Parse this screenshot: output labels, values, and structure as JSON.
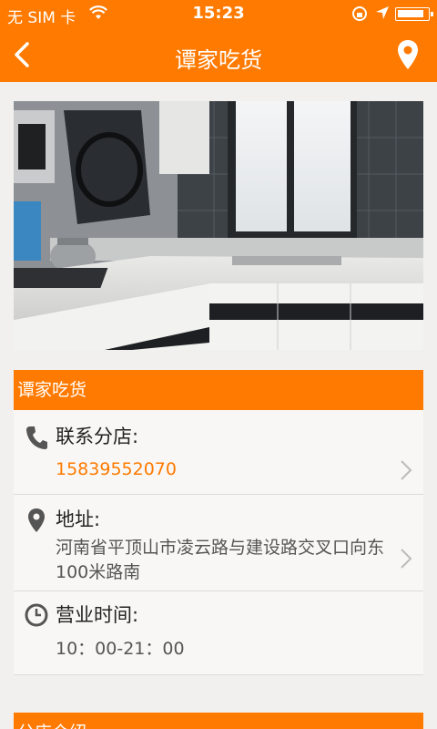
{
  "status": {
    "carrier": "无 SIM 卡",
    "time": "15:23"
  },
  "nav": {
    "title": "谭家吃货"
  },
  "store": {
    "name": "谭家吃货",
    "contact_label": "联系分店:",
    "phone": "15839552070",
    "address_label": "地址:",
    "address": "河南省平顶山市凌云路与建设路交叉口向东100米路南",
    "hours_label": "营业时间:",
    "hours": "10：00-21：00"
  },
  "next_section": {
    "title": "分店介绍"
  },
  "colors": {
    "accent": "#ff7a00",
    "phone": "#ff7a00"
  },
  "icons": [
    "back-arrow-icon",
    "location-pin-icon",
    "phone-icon",
    "map-pin-icon",
    "clock-icon",
    "chevron-right-icon",
    "wifi-icon",
    "battery-icon"
  ]
}
